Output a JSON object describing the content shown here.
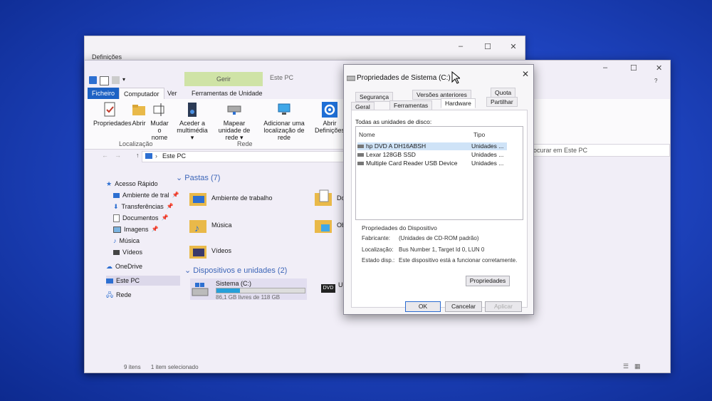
{
  "settings": {
    "title": "Definições"
  },
  "explorer": {
    "gerir": "Gerir",
    "title": "Este PC",
    "tabs": [
      "Ficheiro",
      "Computador",
      "Ver",
      "Ferramentas de Unidade"
    ],
    "ribbon": {
      "propriedades": "Propriedades",
      "abrir": "Abrir",
      "mudar_nome": "Mudar o nome",
      "aceder_multimedia": "Aceder a multimédia ▾",
      "mapear_rede": "Mapear unidade de rede ▾",
      "adicionar_local": "Adicionar uma localização de rede",
      "abrir_definicoes": "Abrir Definições",
      "group_localizacao": "Localização",
      "group_rede": "Rede"
    },
    "address": "Este PC",
    "search_placeholder": "rocurar em Este PC",
    "nav": {
      "acesso_rapido": "Acesso Rápido",
      "ambiente": "Ambiente de tral",
      "transferencias": "Transferências",
      "documentos": "Documentos",
      "imagens": "Imagens",
      "musica": "Música",
      "videos": "Vídeos",
      "onedrive": "OneDrive",
      "este_pc": "Este PC",
      "rede": "Rede"
    },
    "section_pastas": "Pastas (7)",
    "folders": {
      "ambiente": "Ambiente de trabalho",
      "doc": "Doc",
      "musica": "Música",
      "obj": "Obj",
      "videos": "Vídeos"
    },
    "section_dispositivos": "Dispositivos e unidades (2)",
    "drive": {
      "name": "Sistema (C:)",
      "free": "86,1 GB livres de 118 GB",
      "used_fraction": 0.27
    },
    "dvd_label": "DVD",
    "dvd_name": "Uni",
    "status_items": "9 itens",
    "status_selected": "1 item selecionado"
  },
  "dialog": {
    "title": "Propriedades de Sistema (C:)",
    "tabs_top": [
      "Segurança",
      "Versões anteriores",
      "Quota"
    ],
    "tabs_bottom": [
      "Geral",
      "Ferramentas",
      "Hardware",
      "Partilhar"
    ],
    "list_label": "Todas as unidades de disco:",
    "col_nome": "Nome",
    "col_tipo": "Tipo",
    "devices": [
      {
        "name": "hp DVD A  DH16ABSH",
        "type": "Unidades ..."
      },
      {
        "name": "Lexar 128GB SSD",
        "type": "Unidades ..."
      },
      {
        "name": "Multiple Card  Reader USB Device",
        "type": "Unidades ..."
      }
    ],
    "props_title": "Propriedades do Dispositivo",
    "fabricante_label": "Fabricante:",
    "fabricante_value": "(Unidades de CD-ROM padrão)",
    "localizacao_label": "Localização:",
    "localizacao_value": "Bus Number 1, Target Id 0, LUN 0",
    "estado_label": "Estado disp.:",
    "estado_value": "Este dispositivo está a funcionar corretamente.",
    "btn_propriedades": "Propriedades",
    "btn_ok": "OK",
    "btn_cancelar": "Cancelar",
    "btn_aplicar": "Aplicar"
  }
}
